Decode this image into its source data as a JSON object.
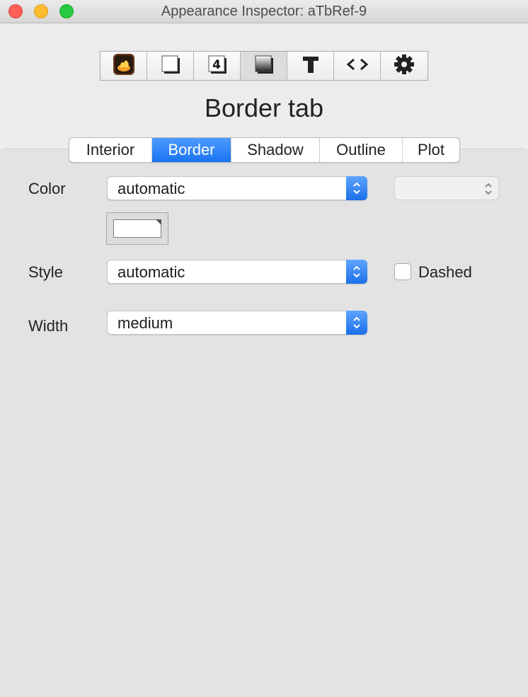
{
  "window": {
    "title": "Appearance Inspector: aTbRef-9"
  },
  "toolbar": {
    "buttons": [
      {
        "name": "inspector-icon"
      },
      {
        "name": "shadow-box-icon"
      },
      {
        "name": "number-four-icon"
      },
      {
        "name": "border-gradient-icon"
      },
      {
        "name": "text-icon"
      },
      {
        "name": "code-icon"
      },
      {
        "name": "gear-icon"
      }
    ],
    "selected_index": 3
  },
  "heading": "Border tab",
  "tabs": [
    {
      "label": "Interior",
      "active": false
    },
    {
      "label": "Border",
      "active": true
    },
    {
      "label": "Shadow",
      "active": false
    },
    {
      "label": "Outline",
      "active": false
    },
    {
      "label": "Plot",
      "active": false
    }
  ],
  "form": {
    "color": {
      "label": "Color",
      "value": "automatic",
      "secondary_value": "",
      "swatch_color": "#ffffff"
    },
    "style": {
      "label": "Style",
      "value": "automatic",
      "dashed_label": "Dashed",
      "dashed_checked": false
    },
    "width": {
      "label": "Width",
      "value": "medium"
    }
  },
  "colors": {
    "accent": "#1a73f0",
    "panel": "#e3e3e3",
    "window": "#ececec"
  }
}
